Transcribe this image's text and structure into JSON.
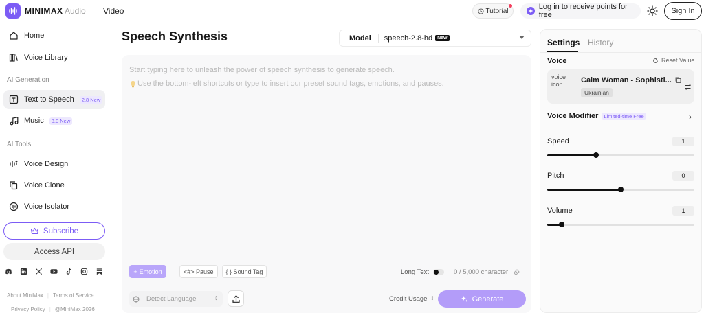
{
  "header": {
    "brand": "MINIMAX",
    "brand_sub": "Audio",
    "nav_video": "Video",
    "tutorial": "Tutorial",
    "login_points": "Log in to receive points for free",
    "signin": "Sign In"
  },
  "sidebar": {
    "items": [
      {
        "label": "Home",
        "icon": "home-icon"
      },
      {
        "label": "Voice Library",
        "icon": "library-icon"
      }
    ],
    "section_generation": "AI Generation",
    "generation_items": [
      {
        "label": "Text to Speech",
        "badge": "2.8 New",
        "icon": "tts-icon",
        "active": true
      },
      {
        "label": "Music",
        "badge": "3.0 New",
        "icon": "music-icon"
      }
    ],
    "section_tools": "AI Tools",
    "tool_items": [
      {
        "label": "Voice Design",
        "icon": "voice-design-icon"
      },
      {
        "label": "Voice Clone",
        "icon": "voice-clone-icon"
      },
      {
        "label": "Voice Isolator",
        "icon": "voice-isolator-icon"
      }
    ],
    "subscribe": "Subscribe",
    "access_api": "Access API",
    "socials": [
      "discord-icon",
      "linkedin-icon",
      "x-icon",
      "youtube-icon",
      "tiktok-icon",
      "instagram-icon",
      "substack-icon"
    ],
    "footer": {
      "about": "About MiniMax",
      "terms": "Terms of Service",
      "privacy": "Privacy Policy",
      "copyright": "@MiniMax 2026"
    }
  },
  "main": {
    "title": "Speech Synthesis",
    "model_label": "Model",
    "model_value": "speech-2.8-hd",
    "model_badge": "New",
    "placeholder_line1": "Start typing here to unleash the power of speech synthesis to generate speech.",
    "placeholder_line2": "Use the bottom-left shortcuts or type to insert our preset sound tags, emotions, and pauses.",
    "emotion": "Emotion",
    "pause": "<#> Pause",
    "sound_tag": "{ } Sound Tag",
    "long_text": "Long Text",
    "char_count": "0 / 5,000 character",
    "detect_language": "Detect Language",
    "credit_usage": "Credit Usage",
    "generate": "Generate"
  },
  "settings": {
    "tab_settings": "Settings",
    "tab_history": "History",
    "voice_label": "Voice",
    "reset": "Reset Value",
    "voice_img_alt": "voice icon",
    "voice_name": "Calm Woman - Sophisti...",
    "voice_lang": "Ukrainian",
    "modifier": "Voice Modifier",
    "modifier_badge": "Limited-time Free",
    "speed_label": "Speed",
    "speed_value": "1",
    "pitch_label": "Pitch",
    "pitch_value": "0",
    "volume_label": "Volume",
    "volume_value": "1",
    "slider_levels": {
      "speed": 0.33,
      "pitch": 0.5,
      "volume": 0.1
    }
  },
  "colors": {
    "accent": "#7c5cf5",
    "generate_bg": "#b39cf9"
  }
}
